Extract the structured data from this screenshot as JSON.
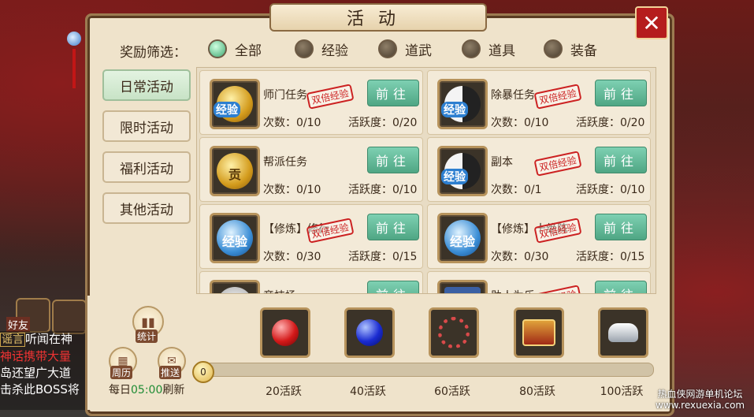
{
  "title": "活动",
  "close_label": "✕",
  "filter": {
    "label": "奖励筛选：",
    "options": [
      {
        "label": "全部",
        "selected": true
      },
      {
        "label": "经验",
        "selected": false
      },
      {
        "label": "道武",
        "selected": false
      },
      {
        "label": "道具",
        "selected": false
      },
      {
        "label": "装备",
        "selected": false
      }
    ]
  },
  "tabs": [
    {
      "label": "日常活动",
      "active": true
    },
    {
      "label": "限时活动",
      "active": false
    },
    {
      "label": "福利活动",
      "active": false
    },
    {
      "label": "其他活动",
      "active": false
    }
  ],
  "activities": [
    {
      "name": "师门任务",
      "icon": "exp-coin-icon",
      "icon_text": "经验",
      "double": "双倍经验",
      "button": "前往",
      "count": "次数：0/10",
      "activity": "活跃度：0/20"
    },
    {
      "name": "除暴任务",
      "icon": "yin-yang-exp-icon",
      "icon_text": "经验",
      "double": "双倍经验",
      "button": "前往",
      "count": "次数：0/10",
      "activity": "活跃度：0/20"
    },
    {
      "name": "帮派任务",
      "icon": "gong-coin-icon",
      "icon_text": "贡",
      "double": "",
      "button": "前往",
      "count": "次数：0/10",
      "activity": "活跃度：0/10"
    },
    {
      "name": "副本",
      "icon": "yin-yang-exp-icon",
      "icon_text": "经验",
      "double": "双倍经验",
      "button": "前往",
      "count": "次数：0/1",
      "activity": "活跃度：0/10"
    },
    {
      "name": "【修炼】修行",
      "icon": "exp-badge-icon",
      "icon_text": "经验",
      "double": "双倍经验",
      "button": "前往",
      "count": "次数：0/30",
      "activity": "活跃度：0/15"
    },
    {
      "name": "【修炼】十绝阵",
      "icon": "exp-badge-icon",
      "icon_text": "经验",
      "double": "双倍经验",
      "button": "前往",
      "count": "次数：0/30",
      "activity": "活跃度：0/15"
    },
    {
      "name": "竞技场",
      "icon": "silver-icon",
      "icon_text": "",
      "double": "",
      "button": "前往",
      "count": "",
      "activity": ""
    },
    {
      "name": "助人为乐",
      "icon": "book-icon",
      "icon_text": "",
      "double": "双倍经验",
      "button": "前往",
      "count": "",
      "activity": ""
    }
  ],
  "bottom": {
    "stats_label": "统计",
    "calendar_label": "周历",
    "push_label": "推送",
    "refresh_prefix": "每日",
    "refresh_time": "05:00",
    "refresh_suffix": "刷新",
    "progress_value": "0",
    "progress_fraction": 0,
    "rewards": [
      {
        "label": "20活跃",
        "icon": "red-orb-icon"
      },
      {
        "label": "40活跃",
        "icon": "blue-orb-icon"
      },
      {
        "label": "60活跃",
        "icon": "red-beads-icon"
      },
      {
        "label": "80活跃",
        "icon": "treasure-chest-icon"
      },
      {
        "label": "100活跃",
        "icon": "silver-ingot-icon"
      }
    ]
  },
  "left_chat": {
    "lines": [
      {
        "tag": "谣言",
        "text": "听闻在神"
      },
      {
        "tag": "",
        "text": "神话携带大量"
      },
      {
        "tag": "",
        "text": "岛还望广大道"
      },
      {
        "tag": "",
        "text": "击杀此BOSS将"
      }
    ],
    "friend_label": "好友"
  },
  "watermark": {
    "line1": "热血侠网游单机论坛",
    "line2": "www.rexuexia.com"
  }
}
